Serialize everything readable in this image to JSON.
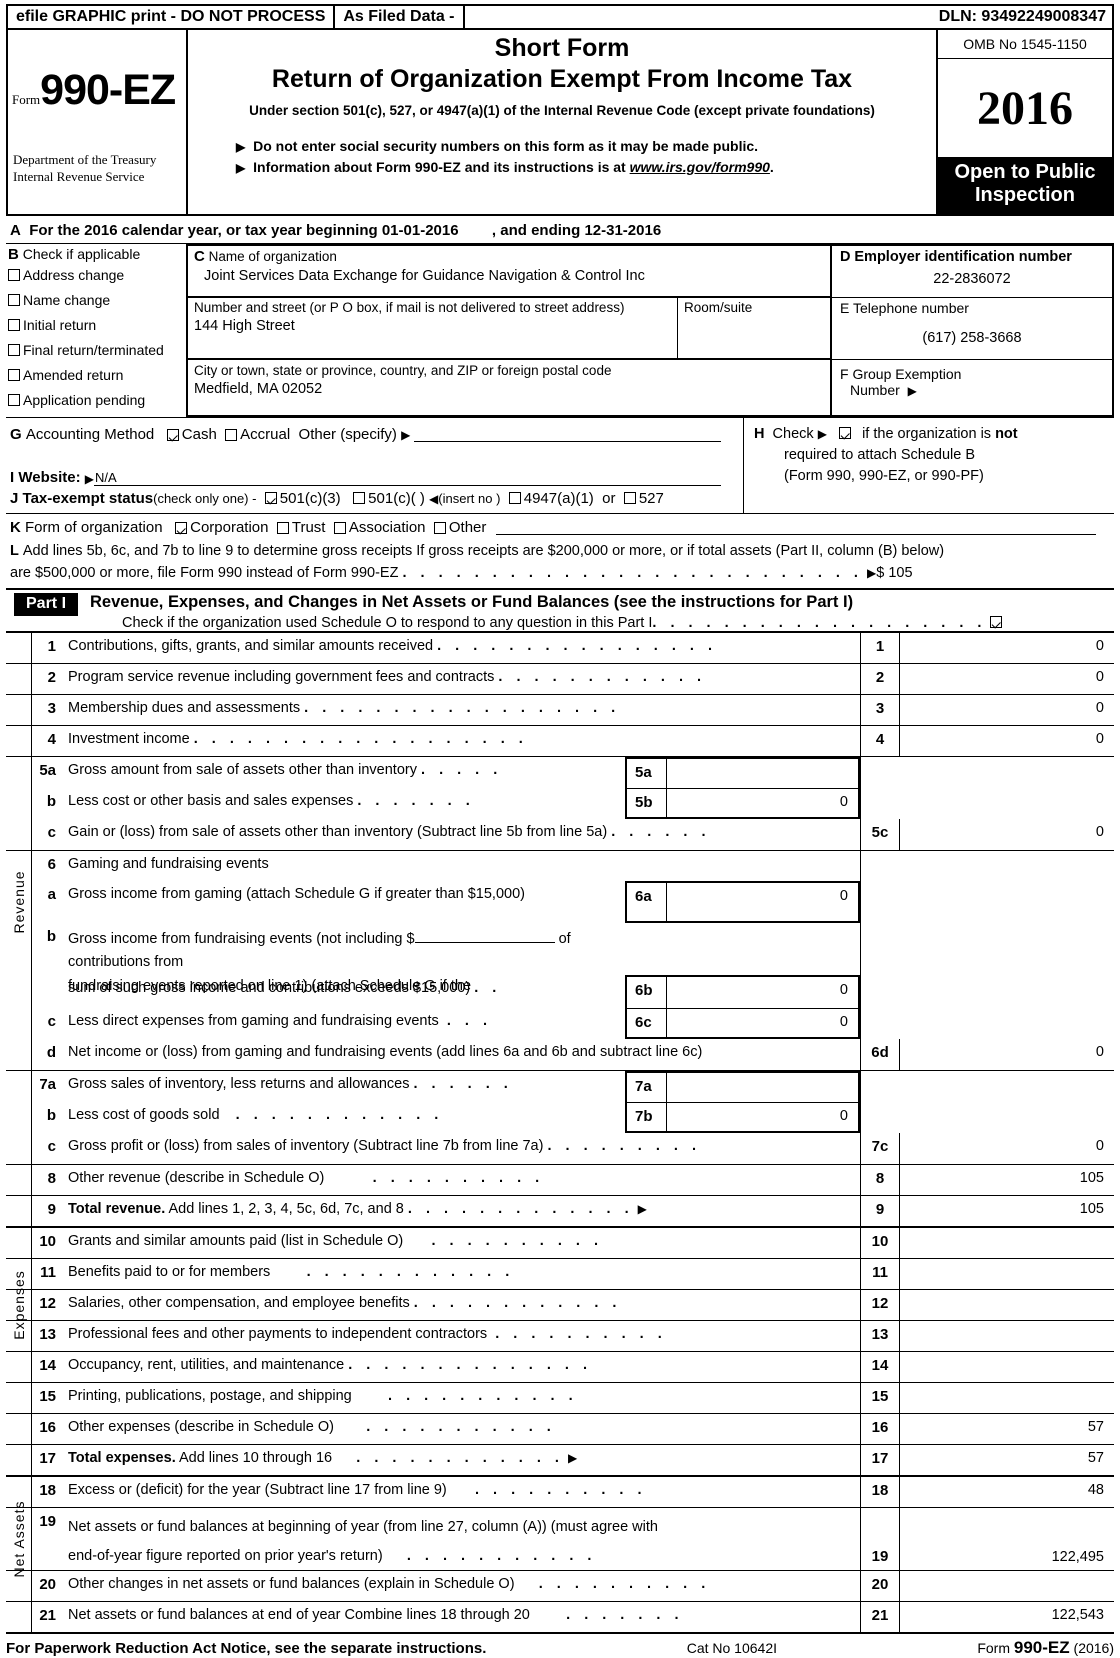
{
  "efile": {
    "print_notice": "efile GRAPHIC print - DO NOT PROCESS",
    "filed_data": "As Filed Data -",
    "dln": "DLN: 93492249008347"
  },
  "masthead": {
    "form_label": "Form",
    "form_number": "990-EZ",
    "department_line1": "Department of the Treasury",
    "department_line2": "Internal Revenue Service",
    "short_form": "Short Form",
    "title": "Return of Organization Exempt From Income Tax",
    "under_section": "Under section 501(c), 527, or 4947(a)(1) of the Internal Revenue Code (except private foundations)",
    "bullet1": "Do not enter social security numbers on this form as it may be made public.",
    "bullet2_pre": "Information about Form 990-EZ and its instructions is at ",
    "bullet2_link": "www.irs.gov/form990",
    "bullet2_post": ".",
    "omb": "OMB No  1545-1150",
    "year": "2016",
    "open_line1": "Open to Public",
    "open_line2": "Inspection"
  },
  "lineA": {
    "letter": "A",
    "text_pre": "For the 2016 calendar year, or tax year beginning",
    "begin_date": "01-01-2016",
    "text_mid": ", and ending",
    "end_date": "12-31-2016"
  },
  "sectionB": {
    "letter": "B",
    "heading": "Check if applicable",
    "items": [
      {
        "label": "Address change",
        "checked": false
      },
      {
        "label": "Name change",
        "checked": false
      },
      {
        "label": "Initial return",
        "checked": false
      },
      {
        "label": "Final return/terminated",
        "checked": false
      },
      {
        "label": "Amended return",
        "checked": false
      },
      {
        "label": "Application pending",
        "checked": false
      }
    ]
  },
  "sectionC": {
    "letter": "C",
    "name_label": "Name of organization",
    "org_name": "Joint Services Data Exchange for Guidance Navigation & Control Inc",
    "street_label": "Number and street (or P  O  box, if mail is not delivered to street address)",
    "street_value": "144 High Street",
    "room_label": "Room/suite",
    "room_value": "",
    "city_label": "City or town, state or province, country, and ZIP or foreign postal code",
    "city_value": "Medfield, MA  02052"
  },
  "sectionD": {
    "letter": "D",
    "label": "Employer identification number",
    "value": "22-2836072"
  },
  "sectionE": {
    "letter": "E",
    "label": "Telephone number",
    "value": "(617) 258-3668"
  },
  "sectionF": {
    "letter": "F",
    "label_line1": "Group Exemption",
    "label_line2": "Number"
  },
  "sectionG": {
    "letter": "G",
    "label": "Accounting Method",
    "cash_label": "Cash",
    "cash_checked": true,
    "accrual_label": "Accrual",
    "accrual_checked": false,
    "other_label": "Other (specify)",
    "other_value": ""
  },
  "sectionH": {
    "letter": "H",
    "check_label": "Check",
    "checked": true,
    "text_line1_pre": "if the organization is ",
    "text_line1_bold": "not",
    "text_line2": "required to attach Schedule B",
    "text_line3": "(Form 990, 990-EZ, or 990-PF)"
  },
  "sectionI": {
    "letter": "I",
    "label": "Website:",
    "value": "N/A"
  },
  "sectionJ": {
    "letter": "J",
    "label": "Tax-exempt status",
    "sub_label": "(check only one) -",
    "opt1": "501(c)(3)",
    "opt1_checked": true,
    "opt2": "501(c)(  )",
    "opt2_checked": false,
    "insert_no": "(insert no )",
    "opt3": "4947(a)(1)",
    "opt3_checked": false,
    "or_text": "or",
    "opt4": "527",
    "opt4_checked": false
  },
  "sectionK": {
    "letter": "K",
    "label": "Form of organization",
    "options": [
      {
        "label": "Corporation",
        "checked": true
      },
      {
        "label": "Trust",
        "checked": false
      },
      {
        "label": "Association",
        "checked": false
      },
      {
        "label": "Other",
        "checked": false
      }
    ]
  },
  "sectionL": {
    "letter": "L",
    "line1": "Add lines 5b, 6c, and 7b to line 9 to determine gross receipts  If gross receipts are $200,000 or more, or if total assets (Part II, column (B) below)",
    "line2": "are $500,000 or more, file Form 990 instead of Form 990-EZ",
    "amount": "$ 105"
  },
  "partI": {
    "badge": "Part I",
    "title": "Revenue, Expenses, and Changes in Net Assets or Fund Balances",
    "title_small": "(see the instructions for Part I)",
    "schedule_o_text": "Check if the organization used Schedule O to respond to any question in this Part I",
    "schedule_o_checked": true,
    "side_revenue": "Revenue",
    "side_expenses": "Expenses",
    "side_netassets": "Net Assets",
    "rows": [
      {
        "num": "1",
        "desc": "Contributions, gifts, grants, and similar amounts received",
        "rnum": "1",
        "value": "0"
      },
      {
        "num": "2",
        "desc": "Program service revenue including government fees and contracts",
        "rnum": "2",
        "value": "0"
      },
      {
        "num": "3",
        "desc": "Membership dues and assessments",
        "rnum": "3",
        "value": "0"
      },
      {
        "num": "4",
        "desc": "Investment income",
        "rnum": "4",
        "value": "0"
      },
      {
        "num": "5a",
        "desc": "Gross amount from sale of assets other than inventory",
        "sub_num": "5a",
        "sub_value": ""
      },
      {
        "num": "b",
        "desc": "Less  cost or other basis and sales expenses",
        "sub_num": "5b",
        "sub_value": "0"
      },
      {
        "num": "c",
        "desc": "Gain or (loss) from sale of assets other than inventory (Subtract line 5b from line 5a)",
        "rnum": "5c",
        "value": "0"
      },
      {
        "num": "6",
        "desc": "Gaming and fundraising events"
      },
      {
        "num": "a",
        "desc": "Gross income from gaming (attach Schedule G if greater than $15,000)",
        "sub_num": "6a",
        "sub_value": "0"
      },
      {
        "num": "b",
        "desc": "Gross income from fundraising events (not including $",
        "desc2": "of contributions from",
        "desc3": "fundraising events reported on line 1) (attach Schedule G if the"
      },
      {
        "num": "",
        "desc": "sum of such gross income and contributions exceeds $15,000)",
        "sub_num": "6b",
        "sub_value": "0"
      },
      {
        "num": "c",
        "desc": "Less  direct expenses from gaming and fundraising events",
        "sub_num": "6c",
        "sub_value": "0"
      },
      {
        "num": "d",
        "desc": "Net income or (loss) from gaming and fundraising events (add lines 6a and 6b and subtract line 6c)",
        "rnum": "6d",
        "value": "0"
      },
      {
        "num": "7a",
        "desc": "Gross sales of inventory, less returns and allowances",
        "sub_num": "7a",
        "sub_value": ""
      },
      {
        "num": "b",
        "desc": "Less  cost of goods sold",
        "sub_num": "7b",
        "sub_value": "0"
      },
      {
        "num": "c",
        "desc": "Gross profit or (loss) from sales of inventory (Subtract line 7b from line 7a)",
        "rnum": "7c",
        "value": "0"
      },
      {
        "num": "8",
        "desc": "Other revenue (describe in Schedule O)",
        "rnum": "8",
        "value": "105"
      },
      {
        "num": "9",
        "desc_bold": "Total revenue.",
        "desc": "Add lines 1, 2, 3, 4, 5c, 6d, 7c, and 8",
        "rnum": "9",
        "value": "105"
      },
      {
        "num": "10",
        "desc": "Grants and similar amounts paid (list in Schedule O)",
        "rnum": "10",
        "value": ""
      },
      {
        "num": "11",
        "desc": "Benefits paid to or for members",
        "rnum": "11",
        "value": ""
      },
      {
        "num": "12",
        "desc": "Salaries, other compensation, and employee benefits",
        "rnum": "12",
        "value": ""
      },
      {
        "num": "13",
        "desc": "Professional fees and other payments to independent contractors",
        "rnum": "13",
        "value": ""
      },
      {
        "num": "14",
        "desc": "Occupancy, rent, utilities, and maintenance",
        "rnum": "14",
        "value": ""
      },
      {
        "num": "15",
        "desc": "Printing, publications, postage, and shipping",
        "rnum": "15",
        "value": ""
      },
      {
        "num": "16",
        "desc": "Other expenses (describe in Schedule O)",
        "rnum": "16",
        "value": "57"
      },
      {
        "num": "17",
        "desc_bold": "Total expenses.",
        "desc": "Add lines 10 through 16",
        "rnum": "17",
        "value": "57"
      },
      {
        "num": "18",
        "desc": "Excess or (deficit) for the year (Subtract line 17 from line 9)",
        "rnum": "18",
        "value": "48"
      },
      {
        "num": "19",
        "desc": "Net assets or fund balances at beginning of year (from line 27, column (A)) (must agree with",
        "desc2": "end-of-year figure reported on prior year's return)",
        "rnum": "19",
        "value": "122,495"
      },
      {
        "num": "20",
        "desc": "Other changes in net assets or fund balances (explain in Schedule O)",
        "rnum": "20",
        "value": ""
      },
      {
        "num": "21",
        "desc": "Net assets or fund balances at end of year  Combine lines 18 through 20",
        "rnum": "21",
        "value": "122,543"
      }
    ]
  },
  "footer": {
    "paperwork": "For Paperwork Reduction Act Notice, see the separate instructions.",
    "cat": "Cat No  10642I",
    "form_pre": "Form ",
    "form_bold": "990-EZ",
    "form_post": " (2016)"
  }
}
